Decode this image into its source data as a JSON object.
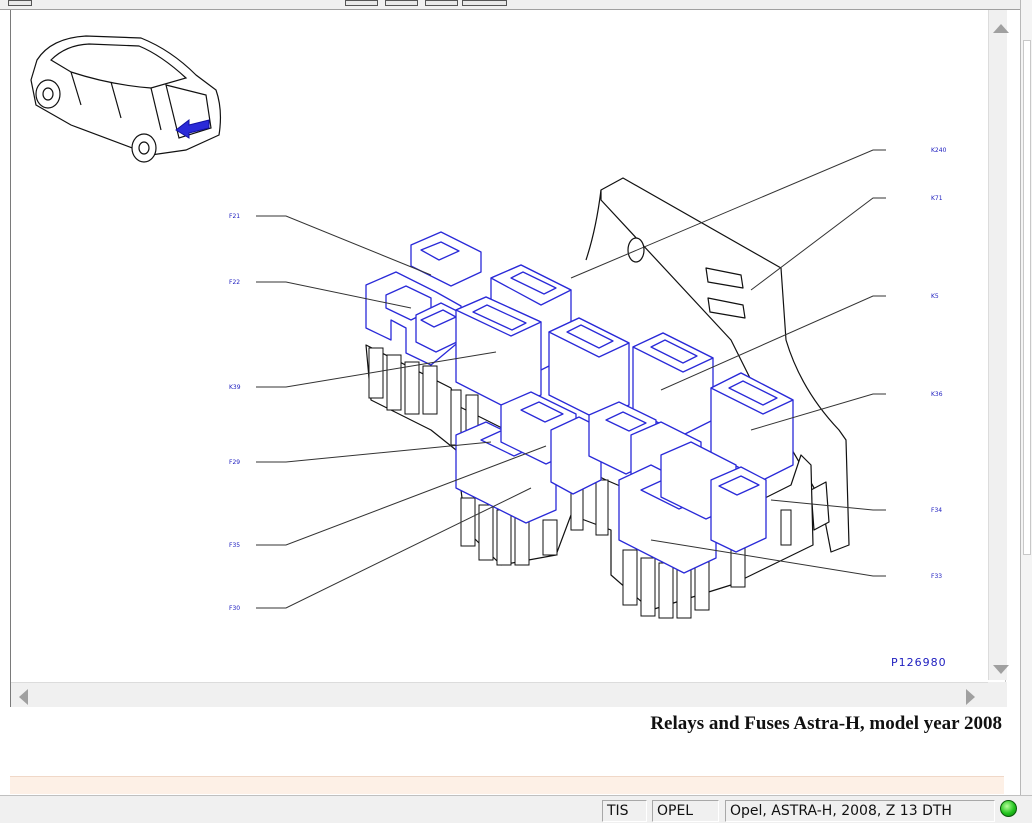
{
  "diagram": {
    "image_id": "P126980",
    "title": "Relays and Fuses Astra-H, model year 2008",
    "callouts": [
      {
        "id": "callout-k240",
        "label": "K240"
      },
      {
        "id": "callout-k71",
        "label": "K71"
      },
      {
        "id": "callout-k5",
        "label": "K5"
      },
      {
        "id": "callout-k36",
        "label": "K36"
      },
      {
        "id": "callout-f34",
        "label": "F34"
      },
      {
        "id": "callout-f33",
        "label": "F33"
      },
      {
        "id": "callout-f21",
        "label": "F21"
      },
      {
        "id": "callout-f22",
        "label": "F22"
      },
      {
        "id": "callout-k39",
        "label": "K39"
      },
      {
        "id": "callout-f29",
        "label": "F29"
      },
      {
        "id": "callout-f35",
        "label": "F35"
      },
      {
        "id": "callout-f30",
        "label": "F30"
      }
    ],
    "highlight_color": "#2a2ad8"
  },
  "status_bar": {
    "system": "TIS",
    "brand": "OPEL",
    "vehicle": "Opel, ASTRA-H, 2008, Z 13 DTH",
    "connection_color": "#22c41e"
  }
}
